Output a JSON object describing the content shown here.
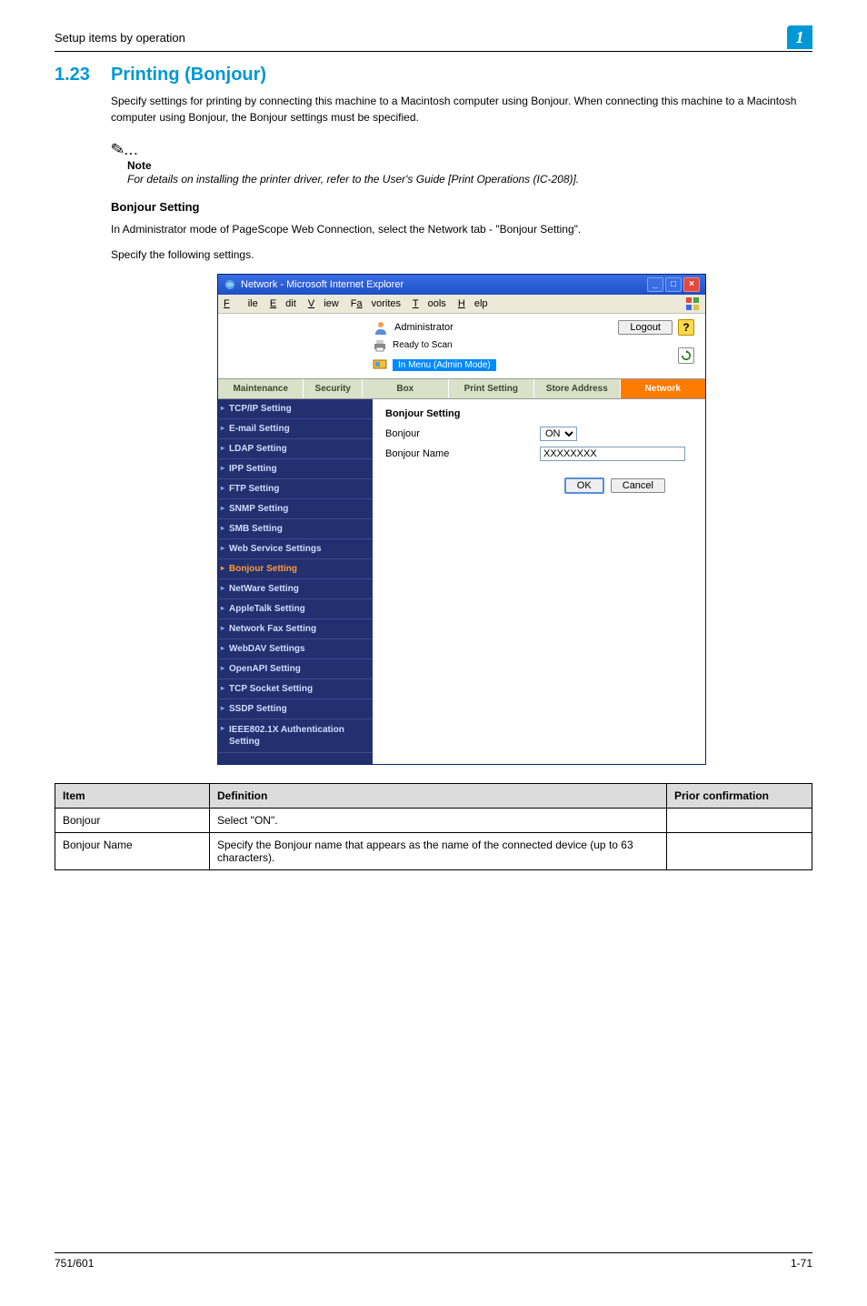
{
  "header": {
    "left": "Setup items by operation",
    "right": "1"
  },
  "section": {
    "number": "1.23",
    "title": "Printing (Bonjour)",
    "intro": "Specify settings for printing by connecting this machine to a Macintosh computer using Bonjour. When connecting this machine to a Macintosh computer using Bonjour, the Bonjour settings must be specified."
  },
  "note": {
    "label": "Note",
    "text": "For details on installing the printer driver, refer to the User's Guide [Print Operations (IC-208)]."
  },
  "sub": {
    "heading": "Bonjour Setting",
    "p1": "In Administrator mode of PageScope Web Connection, select the Network tab - \"Bonjour Setting\".",
    "p2": "Specify the following settings."
  },
  "screenshot": {
    "window_title": "Network - Microsoft Internet Explorer",
    "menubar": {
      "file": "File",
      "edit": "Edit",
      "view": "View",
      "favorites": "Favorites",
      "tools": "Tools",
      "help": "Help"
    },
    "admin_label": "Administrator",
    "logout": "Logout",
    "status_ready": "Ready to Scan",
    "status_menu": "In Menu (Admin Mode)",
    "tabs": {
      "maintenance": "Maintenance",
      "security": "Security",
      "box": "Box",
      "print": "Print Setting",
      "store": "Store Address",
      "network": "Network"
    },
    "sidebar": [
      "TCP/IP Setting",
      "E-mail Setting",
      "LDAP Setting",
      "IPP Setting",
      "FTP Setting",
      "SNMP Setting",
      "SMB Setting",
      "Web Service Settings",
      "Bonjour Setting",
      "NetWare Setting",
      "AppleTalk Setting",
      "Network Fax Setting",
      "WebDAV Settings",
      "OpenAPI Setting",
      "TCP Socket Setting",
      "SSDP Setting",
      "IEEE802.1X Authentication Setting"
    ],
    "panel": {
      "title": "Bonjour Setting",
      "row1_label": "Bonjour",
      "row1_value": "ON",
      "row2_label": "Bonjour Name",
      "row2_value": "XXXXXXXX",
      "ok": "OK",
      "cancel": "Cancel"
    }
  },
  "def_table": {
    "headers": {
      "item": "Item",
      "definition": "Definition",
      "prior": "Prior confirmation"
    },
    "rows": [
      {
        "item": "Bonjour",
        "definition": "Select \"ON\".",
        "prior": ""
      },
      {
        "item": "Bonjour Name",
        "definition": "Specify the Bonjour name that appears as the name of the connected device (up to 63 characters).",
        "prior": ""
      }
    ]
  },
  "footer": {
    "left": "751/601",
    "right": "1-71"
  }
}
